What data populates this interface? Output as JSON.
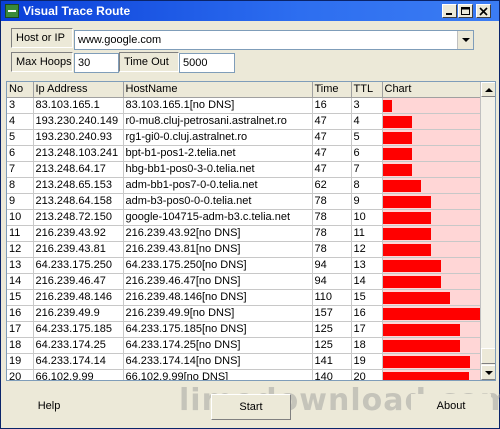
{
  "window": {
    "title": "Visual Trace Route"
  },
  "form": {
    "host_label": "Host or IP",
    "host_value": "www.google.com",
    "maxhoops_label": "Max Hoops",
    "maxhoops_value": "30",
    "timeout_label": "Time Out",
    "timeout_value": "5000"
  },
  "table": {
    "columns": [
      "No",
      "Ip Address",
      "HostName",
      "Time",
      "TTL",
      "Chart"
    ],
    "max_time": 157,
    "rows": [
      {
        "no": "3",
        "ip": "83.103.165.1",
        "host": "83.103.165.1[no DNS]",
        "time": "16",
        "ttl": "3"
      },
      {
        "no": "4",
        "ip": "193.230.240.149",
        "host": "r0-mu8.cluj-petrosani.astralnet.ro",
        "time": "47",
        "ttl": "4"
      },
      {
        "no": "5",
        "ip": "193.230.240.93",
        "host": "rg1-gi0-0.cluj.astralnet.ro",
        "time": "47",
        "ttl": "5"
      },
      {
        "no": "6",
        "ip": "213.248.103.241",
        "host": "bpt-b1-pos1-2.telia.net",
        "time": "47",
        "ttl": "6"
      },
      {
        "no": "7",
        "ip": "213.248.64.17",
        "host": "hbg-bb1-pos0-3-0.telia.net",
        "time": "47",
        "ttl": "7"
      },
      {
        "no": "8",
        "ip": "213.248.65.153",
        "host": "adm-bb1-pos7-0-0.telia.net",
        "time": "62",
        "ttl": "8"
      },
      {
        "no": "9",
        "ip": "213.248.64.158",
        "host": "adm-b3-pos0-0-0.telia.net",
        "time": "78",
        "ttl": "9"
      },
      {
        "no": "10",
        "ip": "213.248.72.150",
        "host": "google-104715-adm-b3.c.telia.net",
        "time": "78",
        "ttl": "10"
      },
      {
        "no": "11",
        "ip": "216.239.43.92",
        "host": "216.239.43.92[no DNS]",
        "time": "78",
        "ttl": "11"
      },
      {
        "no": "12",
        "ip": "216.239.43.81",
        "host": "216.239.43.81[no DNS]",
        "time": "78",
        "ttl": "12"
      },
      {
        "no": "13",
        "ip": "64.233.175.250",
        "host": "64.233.175.250[no DNS]",
        "time": "94",
        "ttl": "13"
      },
      {
        "no": "14",
        "ip": "216.239.46.47",
        "host": "216.239.46.47[no DNS]",
        "time": "94",
        "ttl": "14"
      },
      {
        "no": "15",
        "ip": "216.239.48.146",
        "host": "216.239.48.146[no DNS]",
        "time": "110",
        "ttl": "15"
      },
      {
        "no": "16",
        "ip": "216.239.49.9",
        "host": "216.239.49.9[no DNS]",
        "time": "157",
        "ttl": "16"
      },
      {
        "no": "17",
        "ip": "64.233.175.185",
        "host": "64.233.175.185[no DNS]",
        "time": "125",
        "ttl": "17"
      },
      {
        "no": "18",
        "ip": "64.233.174.25",
        "host": "64.233.174.25[no DNS]",
        "time": "125",
        "ttl": "18"
      },
      {
        "no": "19",
        "ip": "64.233.174.14",
        "host": "64.233.174.14[no DNS]",
        "time": "141",
        "ttl": "19"
      },
      {
        "no": "20",
        "ip": "66.102.9.99",
        "host": "66.102.9.99[no DNS]",
        "time": "140",
        "ttl": "20"
      }
    ]
  },
  "buttons": {
    "help": "Help",
    "start": "Start",
    "about": "About"
  },
  "watermark": "limedownload.com",
  "colors": {
    "bar": "#ff0000",
    "bar_track": "#ffd6d6",
    "title_bar": "#0a3fd8"
  }
}
